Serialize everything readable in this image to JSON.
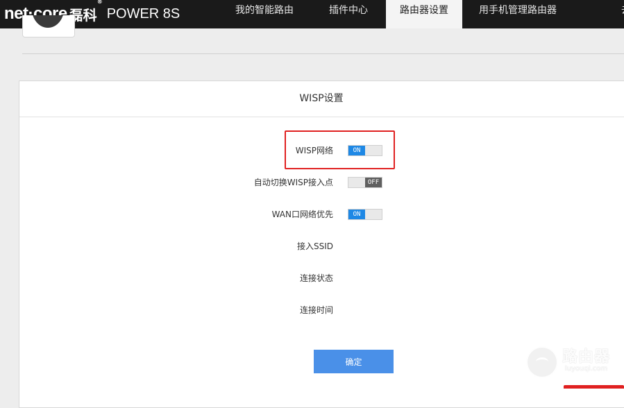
{
  "brand": {
    "logo": "net·core",
    "cn": "磊科",
    "reg": "®",
    "model": "POWER 8S"
  },
  "nav": {
    "tabs": [
      {
        "label": "我的智能路由"
      },
      {
        "label": "插件中心"
      },
      {
        "label": "路由器设置",
        "active": true
      },
      {
        "label": "用手机管理路由器"
      },
      {
        "label": "去"
      }
    ]
  },
  "dialog": {
    "title": "WISP设置",
    "rows": [
      {
        "label": "WISP网络",
        "toggle": "ON"
      },
      {
        "label": "自动切换WISP接入点",
        "toggle": "OFF"
      },
      {
        "label": "WAN口网络优先",
        "toggle": "ON"
      },
      {
        "label": "接入SSID"
      },
      {
        "label": "连接状态"
      },
      {
        "label": "连接时间"
      }
    ],
    "confirm_label": "确定"
  },
  "watermark": {
    "title": "路由器",
    "url": "luyouqi.com"
  },
  "colors": {
    "topbar": "#1a1a1a",
    "toggle_on": "#1e88e5",
    "toggle_off": "#5f5f5f",
    "confirm": "#4a90e8",
    "highlight": "#e02020"
  }
}
